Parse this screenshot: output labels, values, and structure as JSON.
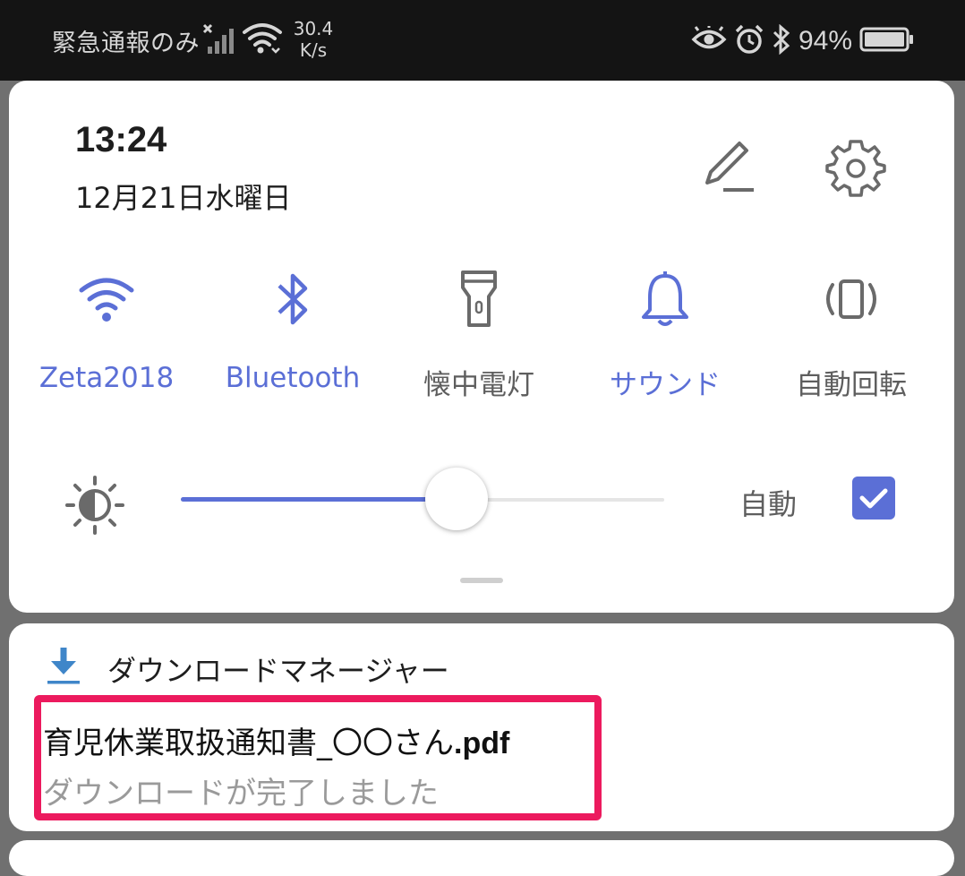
{
  "status_bar": {
    "carrier": "緊急通報のみ",
    "network_speed_value": "30.4",
    "network_speed_unit": "K/s",
    "battery_percent": "94%",
    "icons": [
      "signal-no-sim-icon",
      "wifi-icon",
      "eye-comfort-icon",
      "alarm-icon",
      "bluetooth-icon",
      "battery-icon"
    ]
  },
  "quick_panel": {
    "time": "13:24",
    "date": "12月21日水曜日",
    "tiles": [
      {
        "label": "Zeta2018",
        "icon": "wifi-icon",
        "active": true
      },
      {
        "label": "Bluetooth",
        "icon": "bluetooth-icon",
        "active": true
      },
      {
        "label": "懐中電灯",
        "icon": "flashlight-icon",
        "active": false
      },
      {
        "label": "サウンド",
        "icon": "bell-icon",
        "active": true
      },
      {
        "label": "自動回転",
        "icon": "auto-rotate-icon",
        "active": false
      }
    ],
    "brightness": {
      "level": 0.57,
      "auto_label": "自動",
      "auto_checked": true
    },
    "accent_color": "#5b6fd6"
  },
  "notification": {
    "app_name": "ダウンロードマネージャー",
    "title_name": "育児休業取扱通知書_〇〇さん",
    "title_ext": ".pdf",
    "subtitle": "ダウンロードが完了しました",
    "highlight_color": "#ec1a5e"
  }
}
